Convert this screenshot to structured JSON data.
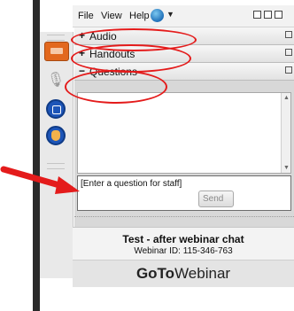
{
  "menubar": {
    "items": [
      "File",
      "View",
      "Help"
    ],
    "globe_icon": "globe-icon",
    "window_controls": [
      "minimize-icon",
      "restore-icon",
      "close-icon"
    ]
  },
  "sections": [
    {
      "label": "Audio",
      "state": "+"
    },
    {
      "label": "Handouts",
      "state": "+"
    },
    {
      "label": "Questions",
      "state": "−"
    }
  ],
  "question_input": {
    "placeholder": "[Enter a question for staff]"
  },
  "send_button": {
    "label": "Send"
  },
  "footer": {
    "webinar_title": "Test - after webinar chat",
    "webinar_id": "Webinar ID: 115-346-763",
    "brand_prefix": "GoTo",
    "brand_suffix": "Webinar"
  },
  "colors": {
    "annotation": "#e41b1b",
    "sidebar_accent": "#e2681e",
    "side_blue": "#1d55b8"
  }
}
